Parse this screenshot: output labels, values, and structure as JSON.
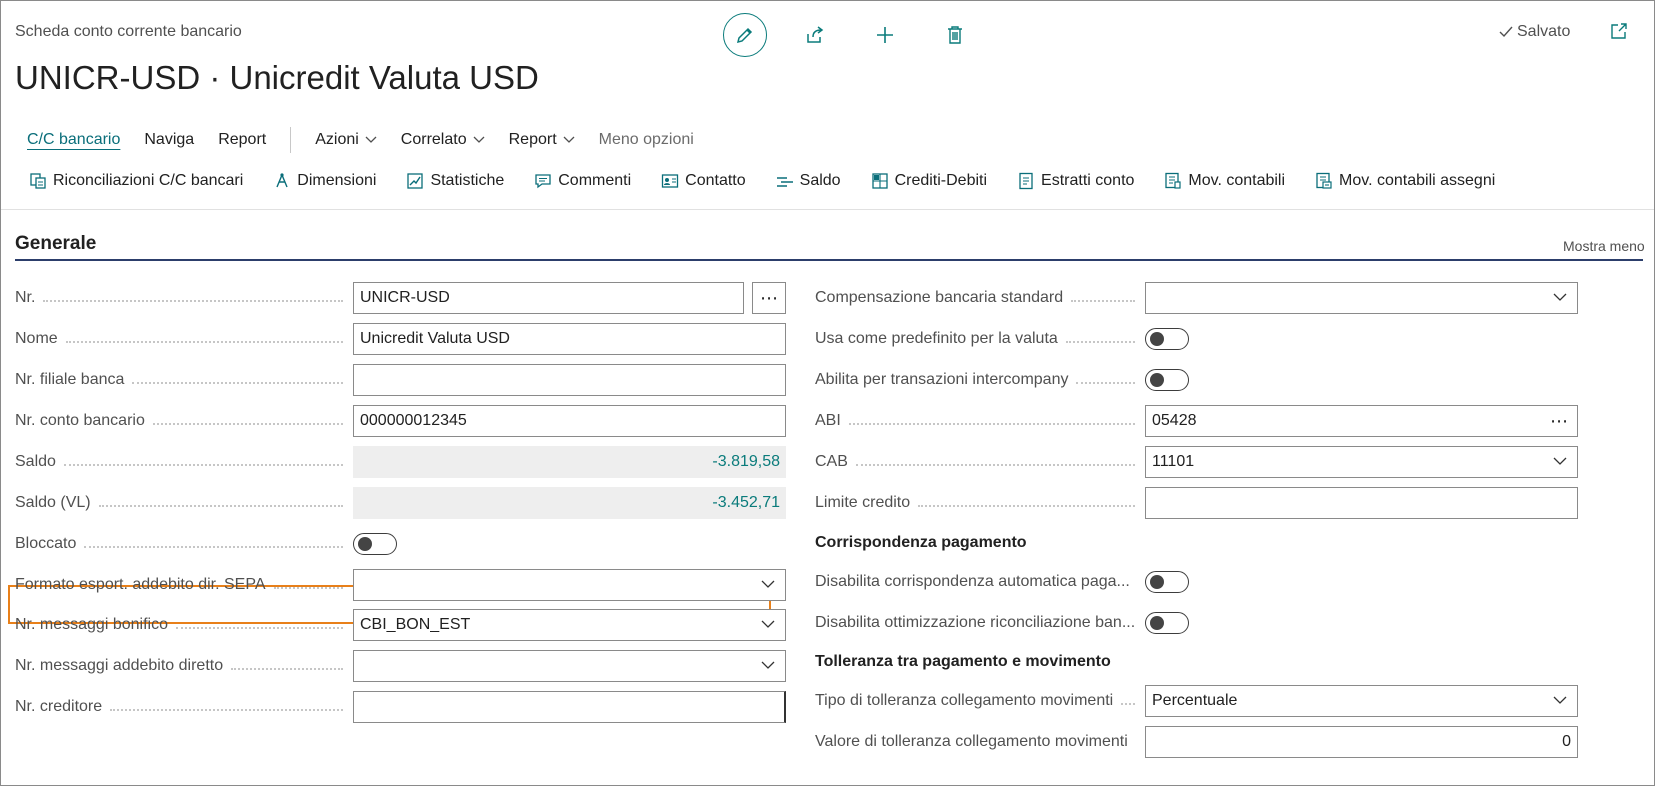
{
  "header": {
    "caption": "Scheda conto corrente bancario",
    "title": "UNICR-USD · Unicredit Valuta USD",
    "status": "Salvato",
    "actions": {
      "edit": "edit-icon",
      "share": "share-icon",
      "new": "plus-icon",
      "delete": "trash-icon",
      "popout": "open-in-new-window-icon"
    }
  },
  "menu": {
    "items": [
      "C/C bancario",
      "Naviga",
      "Report"
    ],
    "dropdowns": [
      "Azioni",
      "Correlato",
      "Report"
    ],
    "less": "Meno opzioni"
  },
  "actionbar": [
    {
      "label": "Riconciliazioni C/C bancari",
      "icon": "reconciliation-icon"
    },
    {
      "label": "Dimensioni",
      "icon": "dimensions-icon"
    },
    {
      "label": "Statistiche",
      "icon": "statistics-icon"
    },
    {
      "label": "Commenti",
      "icon": "comments-icon"
    },
    {
      "label": "Contatto",
      "icon": "contact-icon"
    },
    {
      "label": "Saldo",
      "icon": "balance-icon"
    },
    {
      "label": "Crediti-Debiti",
      "icon": "receivables-payables-icon"
    },
    {
      "label": "Estratti conto",
      "icon": "statements-icon"
    },
    {
      "label": "Mov. contabili",
      "icon": "ledger-entries-icon"
    },
    {
      "label": "Mov. contabili assegni",
      "icon": "check-ledger-entries-icon"
    }
  ],
  "section": {
    "title": "Generale",
    "toggle_label": "Mostra meno"
  },
  "left_fields": [
    {
      "label": "Nr.",
      "value": "UNICR-USD",
      "kind": "text-with-lookup"
    },
    {
      "label": "Nome",
      "value": "Unicredit Valuta USD",
      "kind": "text"
    },
    {
      "label": "Nr. filiale banca",
      "value": "",
      "kind": "text"
    },
    {
      "label": "Nr. conto bancario",
      "value": "000000012345",
      "kind": "text"
    },
    {
      "label": "Saldo",
      "value": "-3.819,58",
      "kind": "readonly"
    },
    {
      "label": "Saldo (VL)",
      "value": "-3.452,71",
      "kind": "readonly"
    },
    {
      "label": "Bloccato",
      "value": "",
      "kind": "toggle",
      "on": false
    },
    {
      "label": "Formato esport. addebito dir. SEPA",
      "value": "",
      "kind": "select"
    },
    {
      "label": "Nr. messaggi bonifico",
      "value": "CBI_BON_EST",
      "kind": "select"
    },
    {
      "label": "Nr. messaggi addebito diretto",
      "value": "",
      "kind": "select"
    },
    {
      "label": "Nr. creditore",
      "value": "",
      "kind": "text"
    }
  ],
  "right_fields": [
    {
      "label": "Compensazione bancaria standard",
      "value": "",
      "kind": "select"
    },
    {
      "label": "Usa come predefinito per la valuta",
      "value": "",
      "kind": "toggle",
      "on": false
    },
    {
      "label": "Abilita per transazioni intercompany",
      "value": "",
      "kind": "toggle",
      "on": false
    },
    {
      "label": "ABI",
      "value": "05428",
      "kind": "text-ellipsis"
    },
    {
      "label": "CAB",
      "value": "11101",
      "kind": "select"
    },
    {
      "label": "Limite credito",
      "value": "",
      "kind": "text"
    }
  ],
  "payment_matching": {
    "title": "Corrispondenza pagamento",
    "fields": [
      {
        "label": "Disabilita corrispondenza automatica paga...",
        "kind": "toggle",
        "on": false
      },
      {
        "label": "Disabilita ottimizzazione riconciliazione ban...",
        "kind": "toggle",
        "on": false
      }
    ]
  },
  "tolerance": {
    "title": "Tolleranza tra pagamento e movimento",
    "fields": [
      {
        "label": "Tipo di tolleranza collegamento movimenti",
        "value": "Percentuale",
        "kind": "select"
      },
      {
        "label": "Valore di tolleranza collegamento movimenti",
        "value": "0",
        "kind": "number"
      }
    ]
  },
  "colors": {
    "accent": "#0a7b7b",
    "section_line": "#2c3e6b",
    "highlight": "#e8801a"
  }
}
